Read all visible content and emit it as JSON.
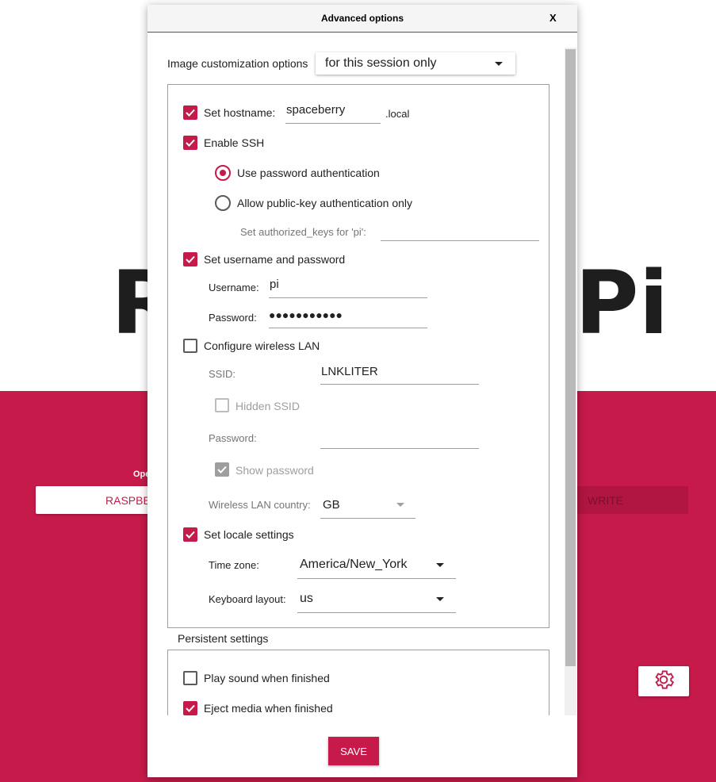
{
  "background": {
    "title_left": "R",
    "title_right": "Pi",
    "os_label": "Ope",
    "os_button": "RASPBE",
    "write_button": "WRITE",
    "gear_icon": "gear-icon",
    "colors": {
      "brand": "#c51a4a"
    }
  },
  "dialog": {
    "title": "Advanced options",
    "close": "X",
    "customization": {
      "label": "Image customization options",
      "selected": "for this session only"
    },
    "hostname": {
      "label": "Set hostname:",
      "value": "spaceberry",
      "suffix": ".local",
      "checked": true
    },
    "ssh": {
      "label": "Enable SSH",
      "checked": true,
      "password_auth": "Use password authentication",
      "pubkey_auth": "Allow public-key authentication only",
      "authorized_keys_label": "Set authorized_keys for 'pi':",
      "authorized_keys_value": ""
    },
    "user": {
      "label": "Set username and password",
      "checked": true,
      "username_label": "Username:",
      "username": "pi",
      "password_label": "Password:",
      "password": "●●●●●●●●●●●"
    },
    "wifi": {
      "label": "Configure wireless LAN",
      "checked": false,
      "ssid_label": "SSID:",
      "ssid": "LNKLITER",
      "hidden_ssid": "Hidden SSID",
      "password_label": "Password:",
      "password": "",
      "show_password": "Show password",
      "country_label": "Wireless LAN country:",
      "country": "GB"
    },
    "locale": {
      "label": "Set locale settings",
      "checked": true,
      "timezone_label": "Time zone:",
      "timezone": "America/New_York",
      "keyboard_label": "Keyboard layout:",
      "keyboard": "us"
    },
    "persistent": {
      "label": "Persistent settings",
      "play_sound": "Play sound when finished",
      "eject_media": "Eject media when finished"
    },
    "save": "SAVE"
  }
}
